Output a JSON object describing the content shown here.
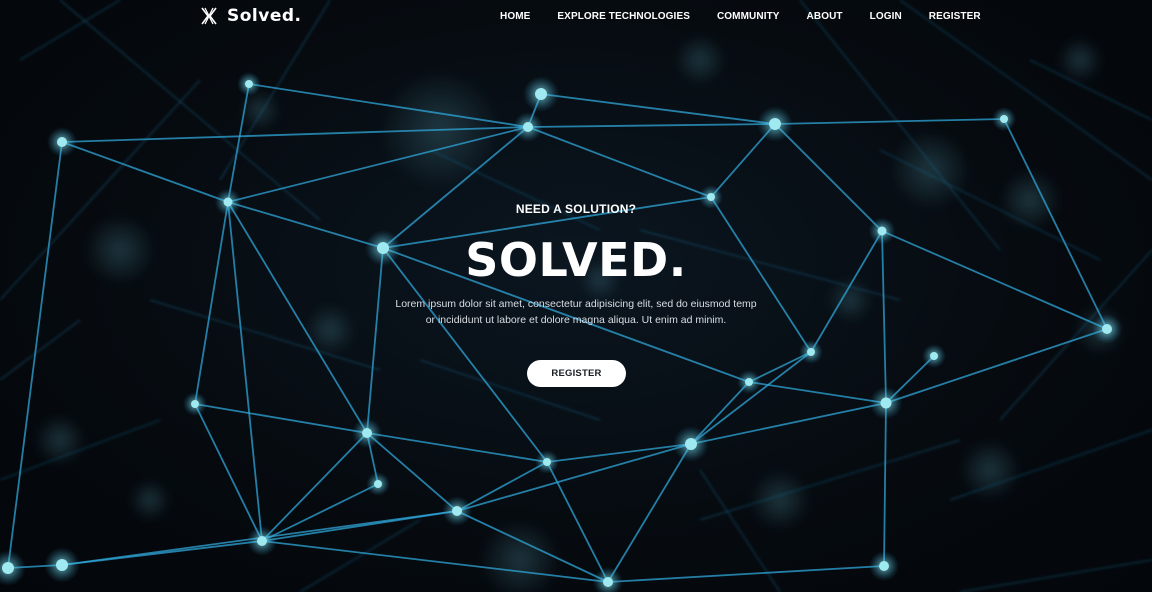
{
  "brand": {
    "name": "Solved.",
    "logo_icon": "crossed-x-logo-icon"
  },
  "nav": {
    "items": [
      {
        "label": "HOME"
      },
      {
        "label": "EXPLORE TECHNOLOGIES"
      },
      {
        "label": "COMMUNITY"
      },
      {
        "label": "ABOUT"
      },
      {
        "label": "LOGIN"
      },
      {
        "label": "REGISTER"
      }
    ]
  },
  "hero": {
    "eyebrow": "NEED A SOLUTION?",
    "title": "SOLVED.",
    "text_line1": "Lorem ipsum dolor sit amet, consectetur adipisicing elit, sed do eiusmod temp",
    "text_line2": "or incididunt ut labore et dolore magna aliqua. Ut enim ad minim.",
    "cta_label": "REGISTER"
  },
  "colors": {
    "background": "#05080c",
    "network_line": "#2e9fd6",
    "network_node": "#8fe3ea",
    "text": "#ffffff",
    "cta_background": "#ffffff",
    "cta_text": "#1a1f24"
  },
  "background_image": {
    "icon": "network-mesh-background"
  }
}
